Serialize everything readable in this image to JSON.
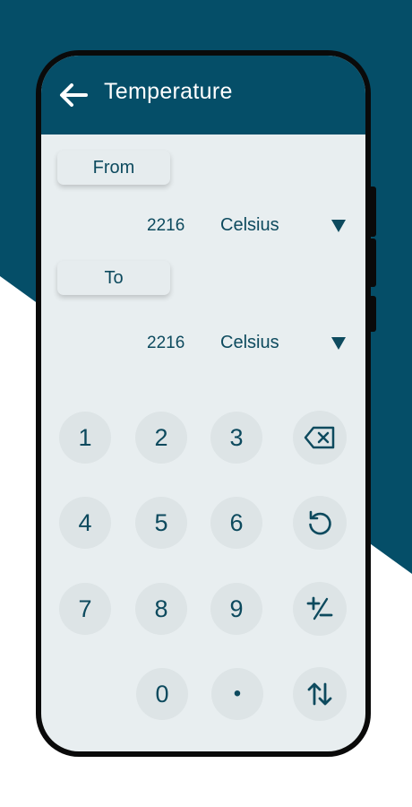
{
  "colors": {
    "primary": "#054e68",
    "screen_bg": "#e8eef0",
    "key_bg": "#dde4e6",
    "text": "#0d4a5e"
  },
  "header": {
    "title": "Temperature",
    "back_icon": "arrow-left-icon"
  },
  "from": {
    "label": "From",
    "value": "2216",
    "unit": "Celsius"
  },
  "to": {
    "label": "To",
    "value": "2216",
    "unit": "Celsius"
  },
  "keypad": {
    "k1": "1",
    "k2": "2",
    "k3": "3",
    "k4": "4",
    "k5": "5",
    "k6": "6",
    "k7": "7",
    "k8": "8",
    "k9": "9",
    "k0": "0",
    "dot": "•",
    "backspace_icon": "backspace-icon",
    "reset_icon": "reset-icon",
    "sign_icon": "plus-minus-icon",
    "swap_icon": "swap-icon"
  }
}
